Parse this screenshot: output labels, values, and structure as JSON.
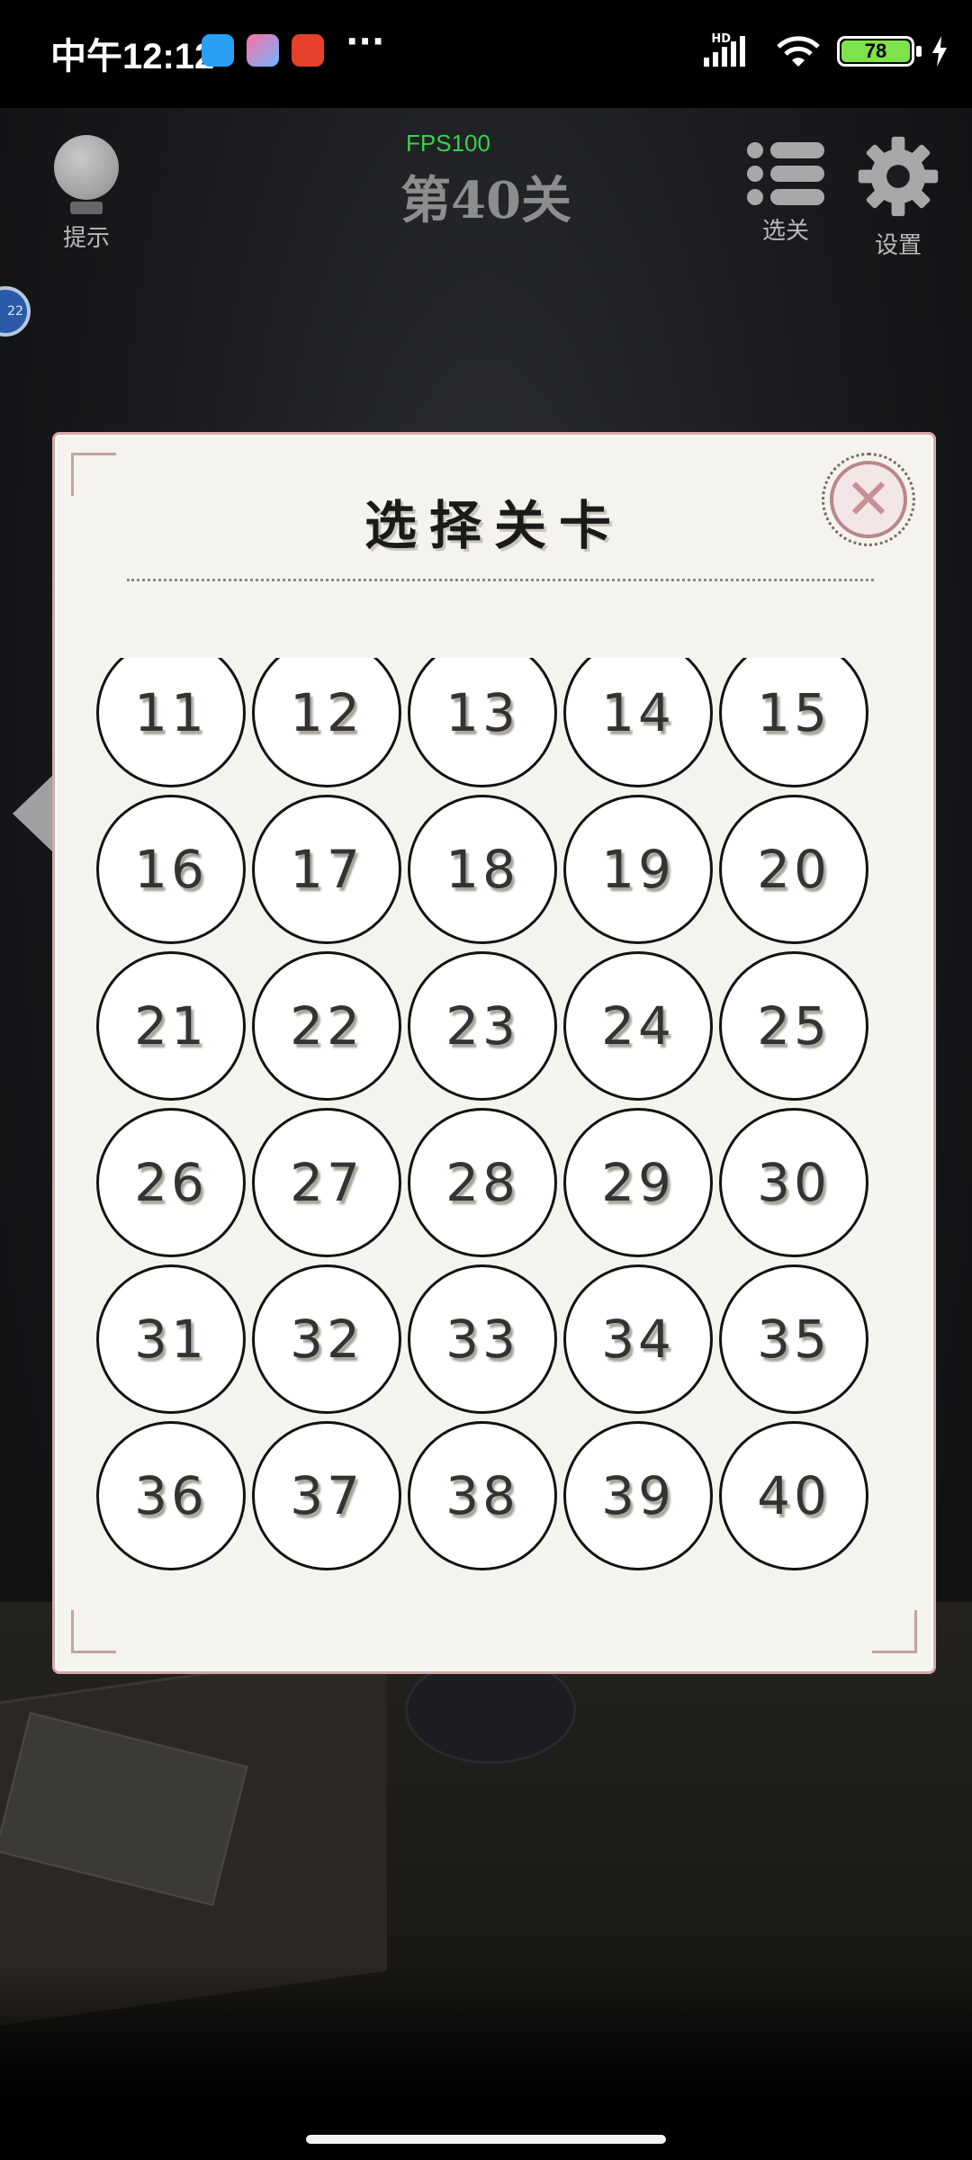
{
  "status_bar": {
    "time": "中午12:12",
    "more": "···",
    "network": "HD",
    "battery": "78",
    "charging": "bolt-icon"
  },
  "hud": {
    "hint_label": "提示",
    "fps": "FPS100",
    "level_title": "第40关",
    "select_label": "选关",
    "settings_label": "设置"
  },
  "modal": {
    "title": "选择关卡",
    "close_icon": "close-icon",
    "levels": [
      "11",
      "12",
      "13",
      "14",
      "15",
      "16",
      "17",
      "18",
      "19",
      "20",
      "21",
      "22",
      "23",
      "24",
      "25",
      "26",
      "27",
      "28",
      "29",
      "30",
      "31",
      "32",
      "33",
      "34",
      "35",
      "36",
      "37",
      "38",
      "39",
      "40"
    ]
  },
  "scene": {
    "badge": "22"
  },
  "colors": {
    "fps": "#38d24a",
    "modal_bg": "#f5f3ee",
    "modal_border": "#d4a9a9",
    "close_x": "#c98e96",
    "battery": "#7ee24a"
  }
}
